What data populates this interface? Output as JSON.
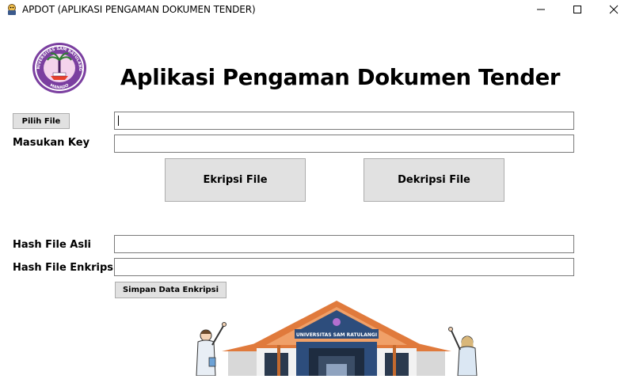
{
  "window": {
    "title": "APDOT (APLIKASI PENGAMAN DOKUMEN TENDER)"
  },
  "logo": {
    "top_text": "UNIVERSITAS SAM RATULANGI",
    "bottom_text": "MANADO"
  },
  "heading": "Aplikasi Pengaman Dokumen Tender",
  "form": {
    "pilih_file_label": "Pilih File",
    "file_path_value": "",
    "key_label": "Masukan Key",
    "key_value": "",
    "encrypt_label": "Ekripsi File",
    "decrypt_label": "Dekripsi File",
    "hash_original_label": "Hash File Asli",
    "hash_original_value": "",
    "hash_encrypted_label": "Hash File Enkripsi",
    "hash_encrypted_value": "",
    "save_label": "Simpan Data Enkripsi"
  },
  "illustration": {
    "sign_text": "UNIVERSITAS SAM RATULANGI"
  },
  "colors": {
    "roof": "#e07a3c",
    "building_blue": "#2d4d7c",
    "button_face": "#e1e1e1",
    "logo_purple": "#7b3fa0"
  }
}
